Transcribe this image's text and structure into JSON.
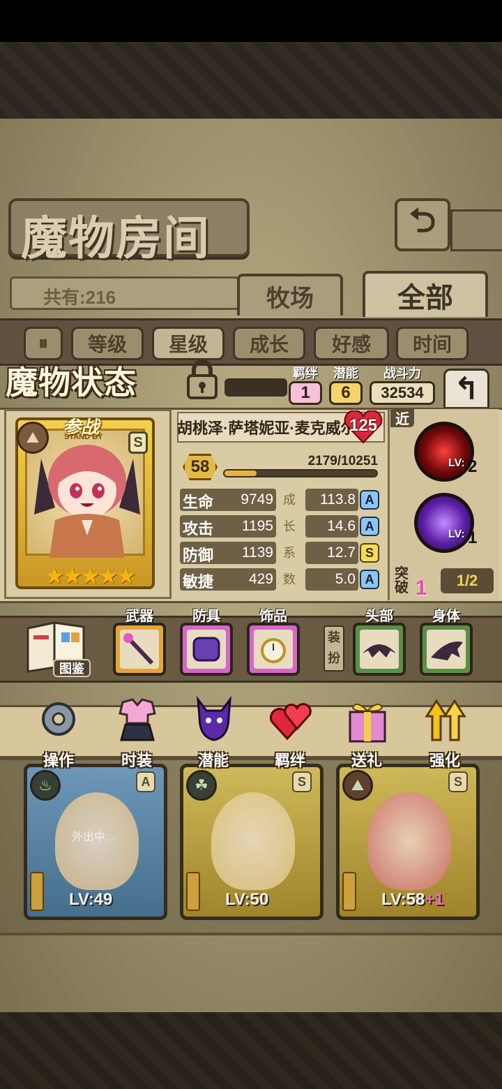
{
  "header": {
    "title": "魔物房间",
    "back_icon": "back-arrow-icon"
  },
  "tabs": {
    "count": "共有:216",
    "ranch": "牧场",
    "all": "全部"
  },
  "sort": {
    "pause_icon": "pause-icon",
    "level": "等级",
    "star": "星级",
    "growth": "成长",
    "favor": "好感",
    "time": "时间"
  },
  "status": {
    "title": "魔物状态",
    "bond_label": "羁绊",
    "bond_value": "1",
    "potential_label": "潜能",
    "potential_value": "6",
    "power_label": "战斗力",
    "power_value": "32534",
    "standby_label": "参战",
    "standby_sub": "STAND BY",
    "rank": "S",
    "stars": 5,
    "name": "胡桃泽·萨塔妮亚·麦克威尔",
    "affection": "125",
    "level": "58",
    "exp": "2179/10251",
    "exp_fraction": 0.2126
  },
  "stats": [
    {
      "name": "生命",
      "value": "9749",
      "growth": "113.8",
      "grade": "A",
      "growth_char": "成"
    },
    {
      "name": "攻击",
      "value": "1195",
      "growth": "14.6",
      "grade": "A",
      "growth_char": "长"
    },
    {
      "name": "防御",
      "value": "1139",
      "growth": "12.7",
      "grade": "S",
      "growth_char": "系"
    },
    {
      "name": "敏捷",
      "value": "429",
      "growth": "5.0",
      "grade": "A",
      "growth_char": "数"
    }
  ],
  "skills": {
    "range": "近",
    "skill1_lv_label": "LV:",
    "skill1_lv": "2",
    "skill2_lv_label": "LV:",
    "skill2_lv": "1",
    "break_label": "突破",
    "break_value": "1",
    "break_ratio": "1/2"
  },
  "equipment": {
    "book_label": "图鉴",
    "weapon": "武器",
    "armor": "防具",
    "accessory": "饰品",
    "dress": "装扮",
    "head": "头部",
    "body": "身体"
  },
  "actions": [
    {
      "label": "操作",
      "icon": "gear-icon"
    },
    {
      "label": "时装",
      "icon": "outfit-icon"
    },
    {
      "label": "潜能",
      "icon": "demon-icon"
    },
    {
      "label": "羁绊",
      "icon": "hearts-icon"
    },
    {
      "label": "送礼",
      "icon": "gift-icon"
    },
    {
      "label": "强化",
      "icon": "upgrade-arrows-icon"
    }
  ],
  "cards": [
    {
      "lv": "LV:49",
      "grade": "A",
      "status": "外出中..."
    },
    {
      "lv": "LV:50",
      "grade": "S"
    },
    {
      "lv": "LV:58",
      "plus": "+1",
      "grade": "S"
    }
  ],
  "colors": {
    "gold": "#e4b944",
    "panel": "#d9cba4",
    "dark": "#4a3f2d",
    "pink": "#e84da8"
  }
}
